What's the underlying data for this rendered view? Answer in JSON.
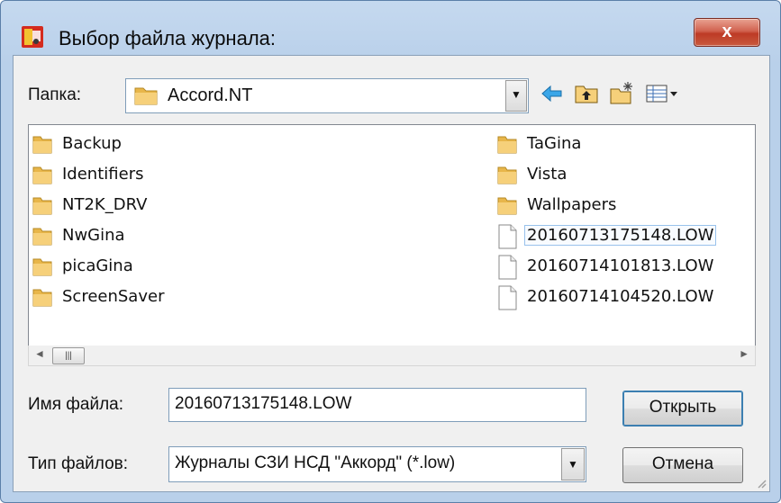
{
  "window": {
    "title": "Выбор файла журнала:",
    "close_label": "x"
  },
  "folder": {
    "label": "Папка:",
    "current": "Accord.NT"
  },
  "toolbar": {
    "icons": [
      "back-icon",
      "up-folder-icon",
      "new-folder-icon",
      "view-menu-icon"
    ]
  },
  "files": {
    "left": [
      {
        "name": "Backup",
        "type": "folder"
      },
      {
        "name": "Identifiers",
        "type": "folder"
      },
      {
        "name": "NT2K_DRV",
        "type": "folder"
      },
      {
        "name": "NwGina",
        "type": "folder"
      },
      {
        "name": "picaGina",
        "type": "folder"
      },
      {
        "name": "ScreenSaver",
        "type": "folder"
      }
    ],
    "right": [
      {
        "name": "TaGina",
        "type": "folder"
      },
      {
        "name": "Vista",
        "type": "folder"
      },
      {
        "name": "Wallpapers",
        "type": "folder"
      },
      {
        "name": "20160713175148.LOW",
        "type": "file",
        "selected": true
      },
      {
        "name": "20160714101813.LOW",
        "type": "file"
      },
      {
        "name": "20160714104520.LOW",
        "type": "file"
      }
    ]
  },
  "filename": {
    "label": "Имя файла:",
    "value": "20160713175148.LOW"
  },
  "filetype": {
    "label": "Тип файлов:",
    "value": "Журналы СЗИ НСД \"Аккорд\" (*.low)"
  },
  "buttons": {
    "open": "Открыть",
    "cancel": "Отмена"
  },
  "colors": {
    "title_gradient": "#c5d9ef",
    "close": "#c95a3f",
    "selection_border": "#99c2ec",
    "folder": "#e8b64a"
  }
}
